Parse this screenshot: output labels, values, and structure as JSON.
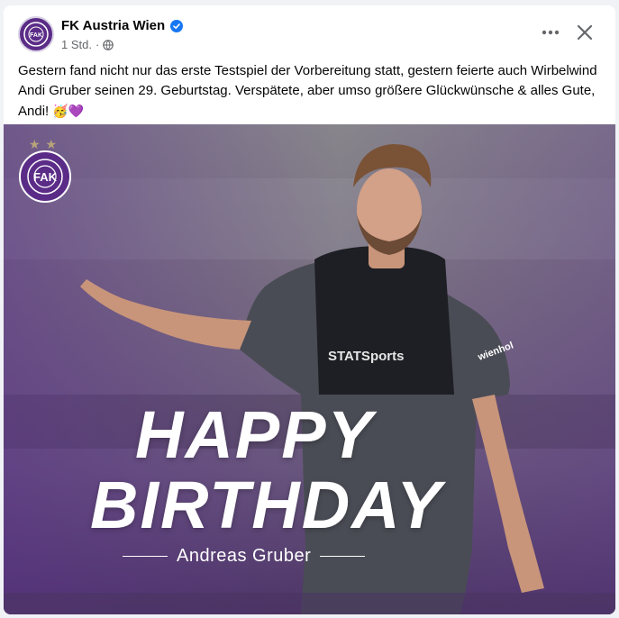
{
  "post": {
    "page_name": "FK Austria Wien",
    "time": "1 Std.",
    "separator": "·",
    "text": "Gestern fand nicht nur das erste Testspiel der Vorbereitung statt, gestern feierte auch Wirbelwind Andi Gruber seinen 29. Geburtstag. Verspätete, aber umso größere Glückwünsche & alles Gute, Andi!",
    "emojis": "🥳💜"
  },
  "header": {
    "more_label": "•••",
    "close_label": "✕"
  },
  "image": {
    "headline_line1": "HAPPY",
    "headline_line2": "BIRTHDAY",
    "player_name": "Andreas Gruber",
    "stars": "★★",
    "crest_text": "FAK",
    "vest_brand": "STATSports",
    "shirt_sponsor": "wienhol"
  },
  "colors": {
    "brand_purple": "#5b2c87",
    "verified_blue": "#1877f2",
    "text_primary": "#050505",
    "text_secondary": "#65676b"
  },
  "icons": {
    "verified": "verified-badge-icon",
    "audience": "globe-icon",
    "more": "more-options-icon",
    "close": "close-icon"
  }
}
